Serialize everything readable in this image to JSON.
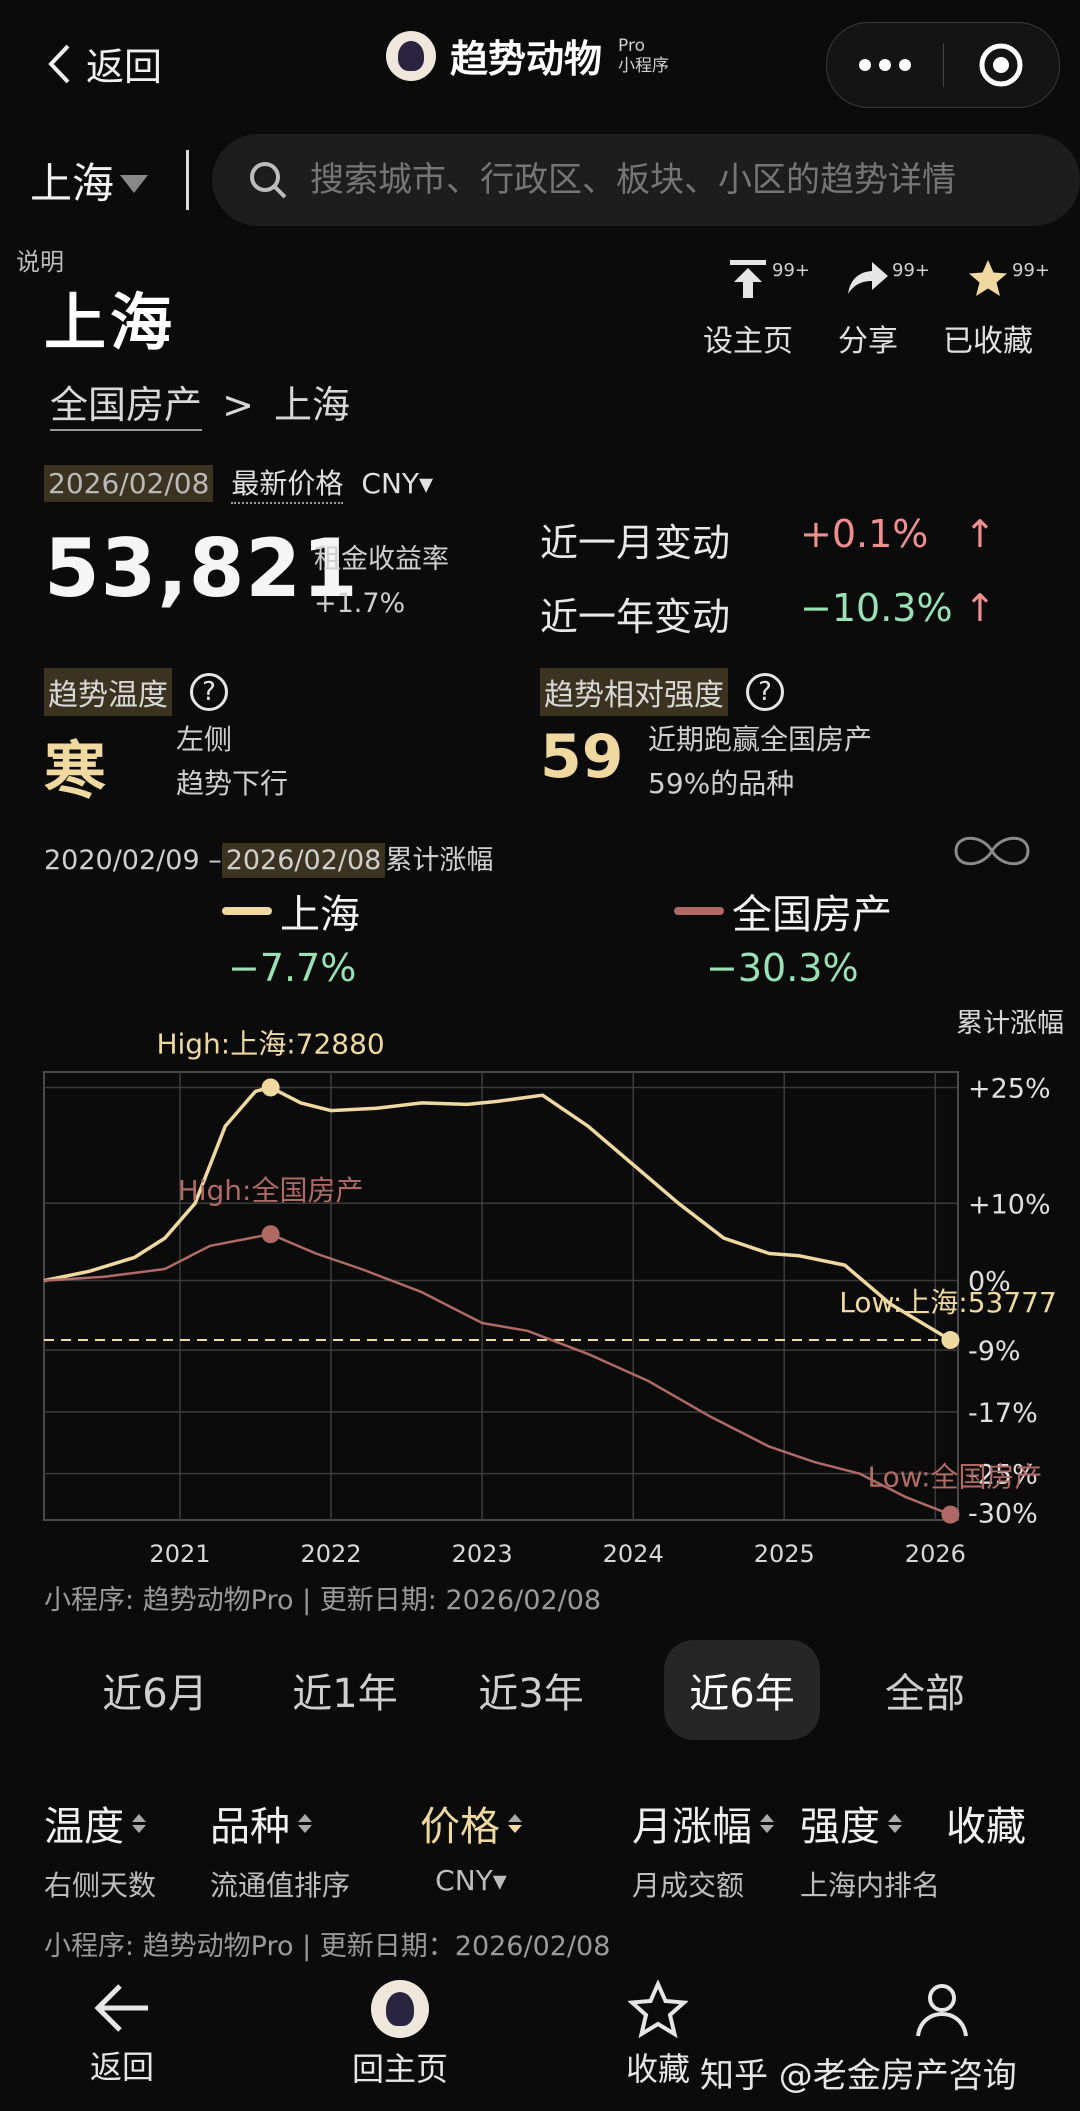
{
  "nav": {
    "back_label": "返回",
    "app_title": "趋势动物",
    "app_pro": "Pro",
    "app_sub": "小程序"
  },
  "search": {
    "city": "上海",
    "placeholder": "搜索城市、行政区、板块、小区的趋势详情"
  },
  "header": {
    "explain": "说明",
    "title": "上海",
    "actions": [
      {
        "label": "设主页",
        "badge": "99+",
        "icon": "set-home-icon"
      },
      {
        "label": "分享",
        "badge": "99+",
        "icon": "share-icon"
      },
      {
        "label": "已收藏",
        "badge": "99+",
        "icon": "star-icon"
      }
    ]
  },
  "breadcrumb": {
    "root": "全国房产",
    "sep": ">",
    "current": "上海"
  },
  "price": {
    "date": "2026/02/08",
    "label": "最新价格",
    "currency": "CNY▾",
    "value": "53,821",
    "yield_label": "租金收益率",
    "yield_value": "+1.7%",
    "month_label": "近一月变动",
    "month_value": "+0.1%",
    "month_arrow": "↑",
    "year_label": "近一年变动",
    "year_value": "−10.3%",
    "year_arrow": "↑"
  },
  "temperature": {
    "label": "趋势温度",
    "value": "寒",
    "desc1": "左侧",
    "desc2": "趋势下行"
  },
  "strength": {
    "label": "趋势相对强度",
    "value": "59",
    "desc1": "近期跑赢全国房产",
    "desc2": "59%的品种"
  },
  "range": {
    "start": "2020/02/09 –",
    "end": "2026/02/08",
    "suffix": "累计涨幅"
  },
  "legend": [
    {
      "name": "上海",
      "pct": "−7.7%",
      "color": "#f0d9a0"
    },
    {
      "name": "全国房产",
      "pct": "−30.3%",
      "color": "#b06a66"
    }
  ],
  "chart_data": {
    "type": "line",
    "ylabel": "累计涨幅",
    "y_ticks": [
      "+25%",
      "+10%",
      "0%",
      "-9%",
      "-17%",
      "-25%",
      "-30%"
    ],
    "x_ticks": [
      "2021",
      "2022",
      "2023",
      "2024",
      "2025",
      "2026"
    ],
    "ylim": [
      -30,
      25
    ],
    "series": [
      {
        "name": "上海",
        "color": "#f0d9a0",
        "x": [
          2020.1,
          2020.4,
          2020.7,
          2020.9,
          2021.1,
          2021.3,
          2021.5,
          2021.6,
          2021.8,
          2022.0,
          2022.3,
          2022.6,
          2022.9,
          2023.1,
          2023.4,
          2023.7,
          2024.0,
          2024.3,
          2024.6,
          2024.9,
          2025.1,
          2025.4,
          2025.7,
          2026.1
        ],
        "values": [
          0,
          1.2,
          3,
          5.5,
          10,
          20,
          24.5,
          25,
          23,
          22,
          22.3,
          23,
          22.8,
          23.2,
          24,
          20,
          15,
          10,
          5.5,
          3.5,
          3.2,
          2,
          -3,
          -7.7
        ]
      },
      {
        "name": "全国房产",
        "color": "#b06a66",
        "x": [
          2020.1,
          2020.5,
          2020.9,
          2021.2,
          2021.6,
          2021.9,
          2022.2,
          2022.6,
          2023.0,
          2023.3,
          2023.7,
          2024.1,
          2024.5,
          2024.9,
          2025.2,
          2025.5,
          2025.8,
          2026.1
        ],
        "values": [
          0,
          0.5,
          1.5,
          4.5,
          6,
          3.5,
          1.5,
          -1.5,
          -5.5,
          -6.5,
          -9.5,
          -13,
          -17.5,
          -21.5,
          -23.5,
          -25,
          -28,
          -30.3
        ]
      }
    ],
    "annotations": [
      {
        "text": "High:上海:72880",
        "series": "上海",
        "x": 2021.6,
        "y": 25
      },
      {
        "text": "High:全国房产",
        "series": "全国房产",
        "x": 2021.6,
        "y": 6
      },
      {
        "text": "Low:上海:53777",
        "series": "上海",
        "x": 2026.1,
        "y": -7.7
      },
      {
        "text": "Low:全国房产",
        "series": "全国房产",
        "x": 2026.1,
        "y": -30.3
      }
    ],
    "reference_line": {
      "y": -7.7,
      "style": "dashed"
    },
    "grid": true
  },
  "footer": {
    "text": "小程序: 趋势动物Pro | 更新日期: 2026/02/08",
    "text2": "小程序: 趋势动物Pro | 更新日期：2026/02/08"
  },
  "period_tabs": [
    "近6月",
    "近1年",
    "近3年",
    "近6年",
    "全部"
  ],
  "sort_header": [
    {
      "title": "温度",
      "sub": "右侧天数"
    },
    {
      "title": "品种",
      "sub": "流通值排序"
    },
    {
      "title": "价格",
      "sub": "CNY▾"
    },
    {
      "title": "月涨幅",
      "sub": "月成交额"
    },
    {
      "title": "强度",
      "sub": "上海内排名"
    },
    {
      "title": "收藏",
      "sub": ""
    }
  ],
  "bottom_nav": [
    {
      "label": "返回",
      "icon": "arrow-left-icon"
    },
    {
      "label": "回主页",
      "icon": "home-avatar-icon"
    },
    {
      "label": "收藏",
      "icon": "star-outline-icon"
    },
    {
      "label": "",
      "icon": "person-icon"
    }
  ],
  "watermark": "知乎 @老金房产咨询"
}
